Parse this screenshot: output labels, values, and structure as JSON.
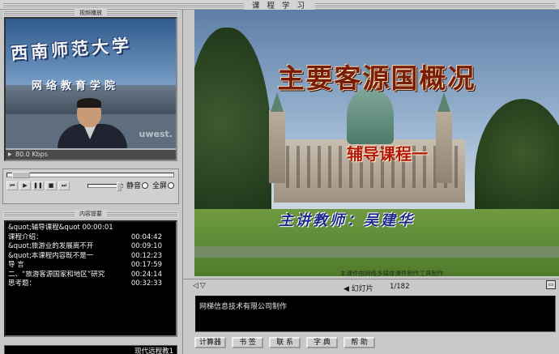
{
  "window": {
    "title": "课 程 学 习"
  },
  "video_panel": {
    "header": "视频播放",
    "banner_line1": "西南师范大学",
    "banner_line2": "网络教育学院",
    "watermark": "uwest.",
    "bitrate": "80.0 Kbps"
  },
  "player_controls": {
    "buttons": [
      "⏮",
      "▶",
      "❚❚",
      "■",
      "⏭"
    ],
    "mute_label": "静音",
    "fullscreen_label": "全屏"
  },
  "content_panel": {
    "header": "内容提要",
    "items": [
      {
        "label": "&quot;辅导课程&quot 00:00:01",
        "time": ""
      },
      {
        "label": "课程介绍：",
        "time": "00:04:42"
      },
      {
        "label": "&quot;旅游业的发展离不开",
        "time": "00:09:10"
      },
      {
        "label": "&quot;本课程内容既不是一",
        "time": "00:12:23"
      },
      {
        "label": "导  言",
        "time": "00:17:59"
      },
      {
        "label": "二、“旅游客源国家和地区”研究",
        "time": "00:24:14"
      },
      {
        "label": "思考题：",
        "time": "00:32:33"
      }
    ],
    "status": "现代远程教1"
  },
  "slide": {
    "title": "主要客源国概况",
    "subtitle": "辅导课程一",
    "lecturer": "主讲教师：吴建华",
    "credit": "本课件由网络多媒体课件制作工具制作"
  },
  "slide_nav": {
    "label": "幻灯片",
    "current": "1",
    "total": "182",
    "counter": "1/182"
  },
  "notes": {
    "text": "网梯信息技术有限公司制作"
  },
  "toolbar": {
    "calculator": "计算器",
    "bookmark": "书 签",
    "contact": "联 系",
    "dictionary": "字 典",
    "help": "帮 助"
  }
}
